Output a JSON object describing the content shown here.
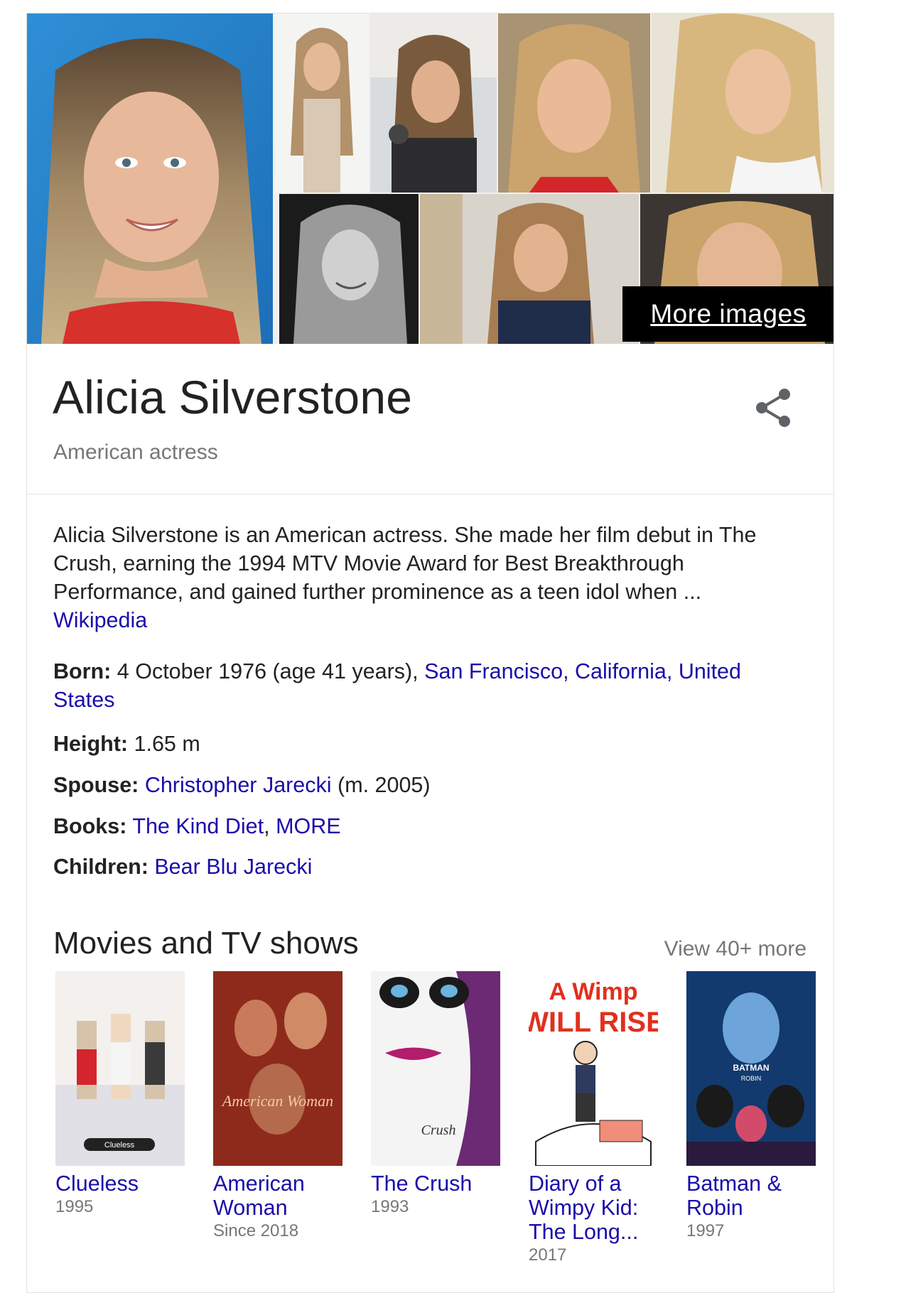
{
  "gallery": {
    "more_images_label": "More images"
  },
  "entity": {
    "name": "Alicia Silverstone",
    "subtitle": "American actress"
  },
  "description": {
    "text": "Alicia Silverstone is an American actress. She made her film debut in The Crush, earning the 1994 MTV Movie Award for Best Breakthrough Performance, and gained further prominence as a teen idol when ...",
    "source_label": "Wikipedia"
  },
  "facts": {
    "born": {
      "label": "Born:",
      "value": " 4 October 1976 (age 41 years), ",
      "place": "San Francisco, California, United States"
    },
    "height": {
      "label": "Height:",
      "value": " 1.65 m"
    },
    "spouse": {
      "label": "Spouse:",
      "name": "Christopher Jarecki",
      "extra": " (m. 2005)"
    },
    "books": {
      "label": "Books:",
      "book1": "The Kind Diet",
      "separator": ", ",
      "more": "MORE"
    },
    "children": {
      "label": "Children:",
      "name": "Bear Blu Jarecki"
    }
  },
  "movies": {
    "section_title": "Movies and TV shows",
    "view_more": "View 40+ more",
    "items": [
      {
        "title": "Clueless",
        "year": "1995"
      },
      {
        "title": "American Woman",
        "year": "Since 2018"
      },
      {
        "title": "The Crush",
        "year": "1993"
      },
      {
        "title": "Diary of a Wimpy Kid: The Long...",
        "year": "2017"
      },
      {
        "title": "Batman & Robin",
        "year": "1997"
      }
    ]
  },
  "poster_text": {
    "clueless_logo": "Clueless",
    "american_woman_logo": "American Woman",
    "crush_logo": "Crush",
    "wimpy_line1": "A Wimp",
    "wimpy_line2": "WILL RISE",
    "batman_line1": "BATMAN",
    "batman_line2": "ROBIN"
  },
  "icons": {
    "share": "share-icon"
  }
}
